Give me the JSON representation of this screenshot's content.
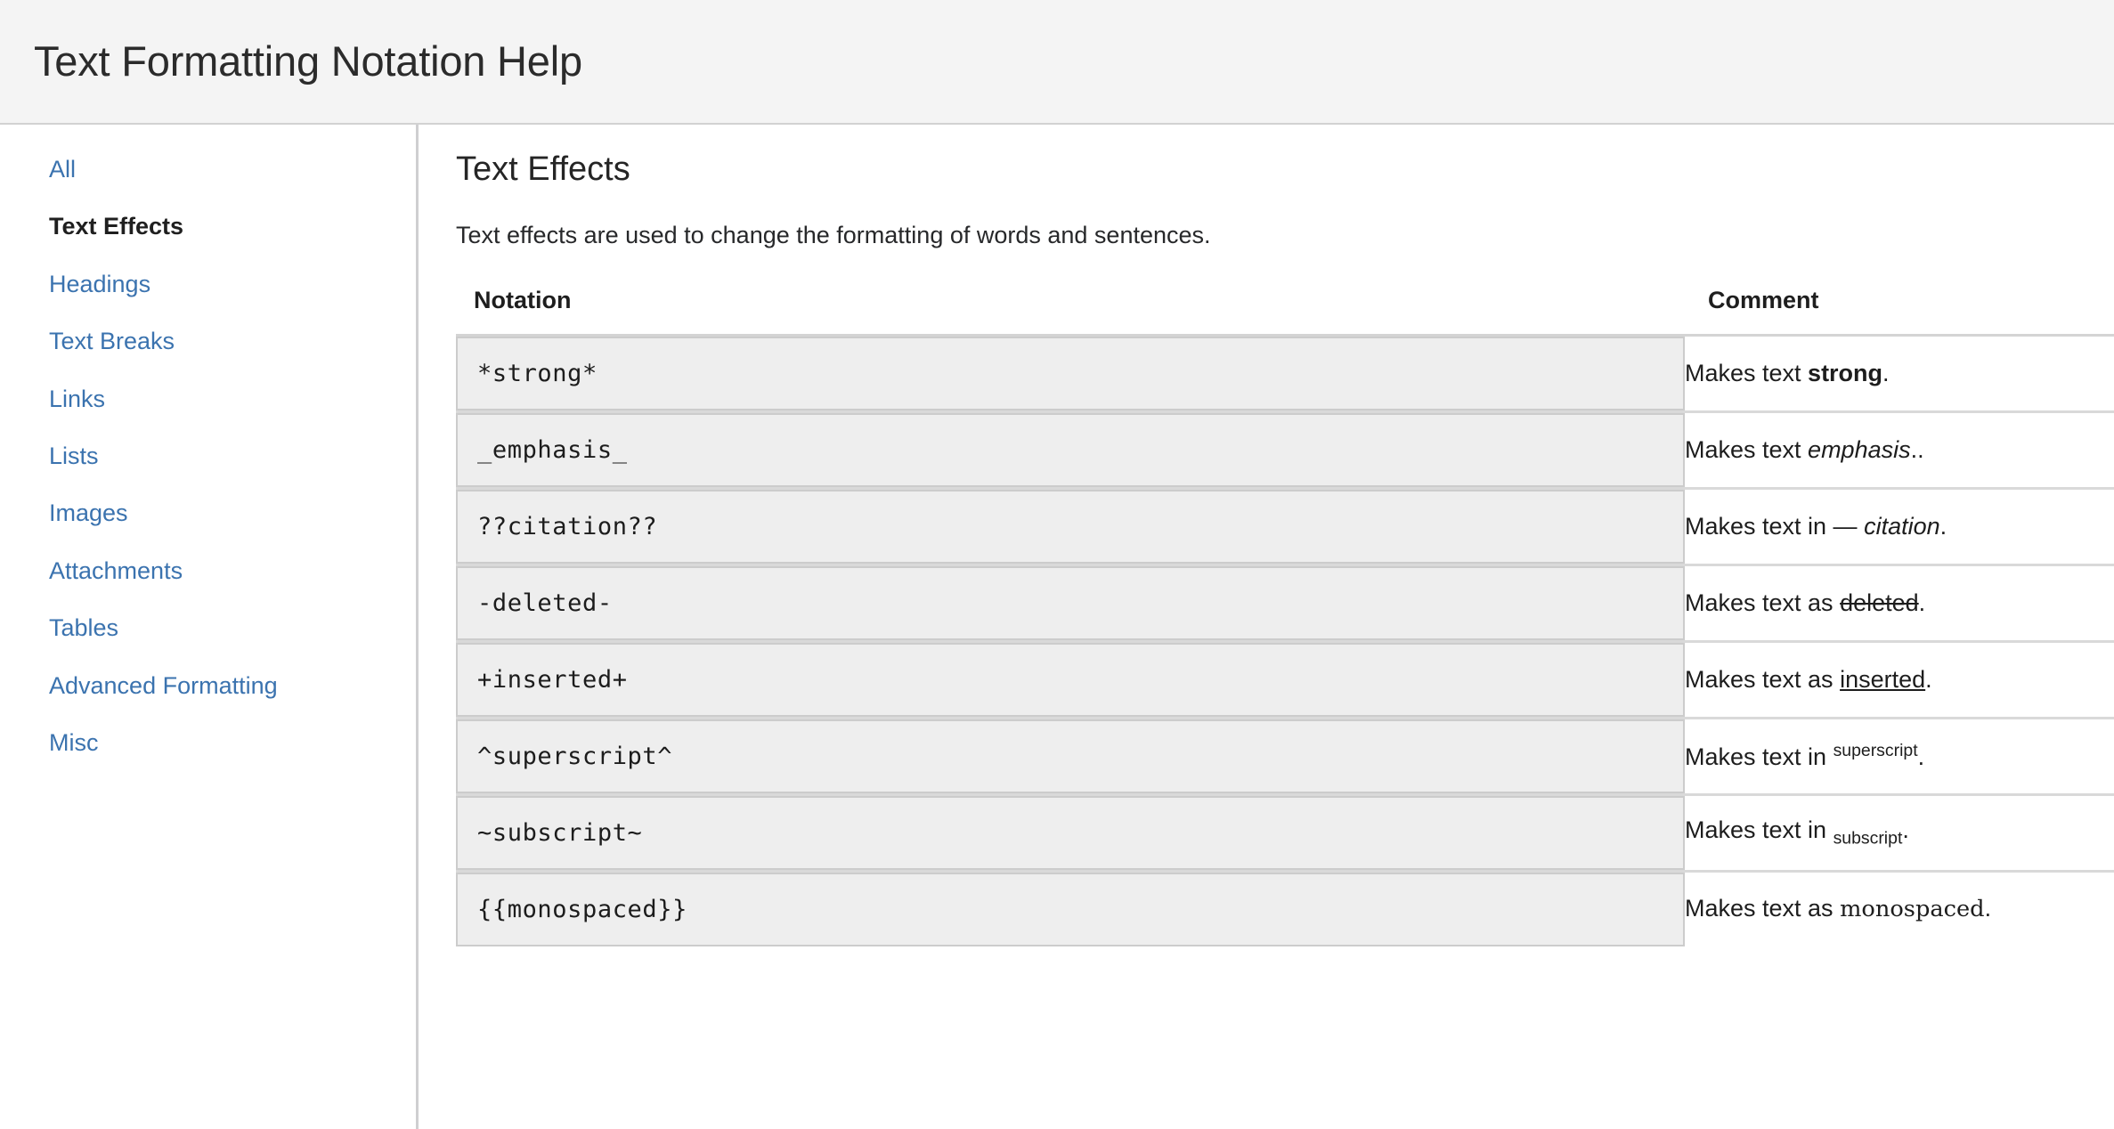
{
  "header": {
    "title": "Text Formatting Notation Help"
  },
  "sidebar": {
    "items": [
      {
        "label": "All",
        "active": false
      },
      {
        "label": "Text Effects",
        "active": true
      },
      {
        "label": "Headings",
        "active": false
      },
      {
        "label": "Text Breaks",
        "active": false
      },
      {
        "label": "Links",
        "active": false
      },
      {
        "label": "Lists",
        "active": false
      },
      {
        "label": "Images",
        "active": false
      },
      {
        "label": "Attachments",
        "active": false
      },
      {
        "label": "Tables",
        "active": false
      },
      {
        "label": "Advanced Formatting",
        "active": false
      },
      {
        "label": "Misc",
        "active": false
      }
    ]
  },
  "main": {
    "section_title": "Text Effects",
    "section_description": "Text effects are used to change the formatting of words and sentences.",
    "table": {
      "columns": [
        "Notation",
        "Comment"
      ],
      "rows": [
        {
          "notation": "*strong*",
          "comment_prefix": "Makes text ",
          "comment_sample": "strong",
          "comment_suffix": ".",
          "sample_style": "bold"
        },
        {
          "notation": "_emphasis_",
          "comment_prefix": "Makes text ",
          "comment_sample": "emphasis",
          "comment_suffix": "..",
          "sample_style": "italic"
        },
        {
          "notation": "??citation??",
          "comment_prefix": "Makes text in — ",
          "comment_sample": "citation",
          "comment_suffix": ".",
          "sample_style": "italic"
        },
        {
          "notation": "-deleted-",
          "comment_prefix": "Makes text as ",
          "comment_sample": "deleted",
          "comment_suffix": ".",
          "sample_style": "strikethrough"
        },
        {
          "notation": "+inserted+",
          "comment_prefix": "Makes text as ",
          "comment_sample": "inserted",
          "comment_suffix": ".",
          "sample_style": "underline"
        },
        {
          "notation": "^superscript^",
          "comment_prefix": "Makes text in ",
          "comment_sample": "superscript",
          "comment_suffix": ".",
          "sample_style": "superscript"
        },
        {
          "notation": "~subscript~",
          "comment_prefix": "Makes text in ",
          "comment_sample": "subscript",
          "comment_suffix": ".",
          "sample_style": "subscript"
        },
        {
          "notation": "{{monospaced}}",
          "comment_prefix": "Makes text as ",
          "comment_sample": "monospaced",
          "comment_suffix": ".",
          "sample_style": "monospace"
        }
      ]
    }
  },
  "colors": {
    "link": "#3b73af",
    "header_background": "#f4f4f4",
    "code_background": "#eeeeee",
    "code_border": "#cccccc",
    "row_divider": "#d9d9d9",
    "text": "#1d1d1d"
  }
}
